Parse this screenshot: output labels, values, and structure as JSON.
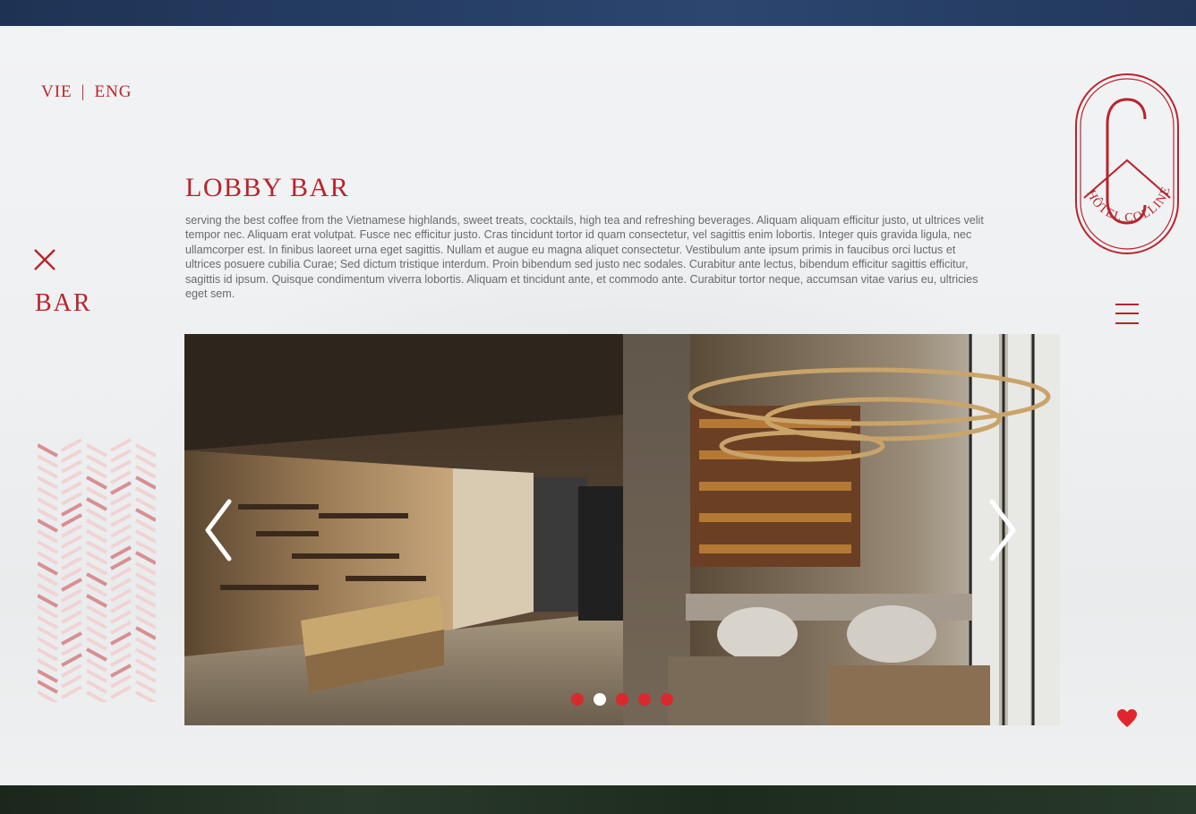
{
  "language_switch": {
    "vie": "VIE",
    "separator": "|",
    "eng": "ENG"
  },
  "section": {
    "label": "BAR"
  },
  "content": {
    "title": "LOBBY BAR",
    "description": "serving the best coffee from the Vietnamese highlands, sweet treats, cocktails, high tea and refreshing beverages. Aliquam aliquam efficitur justo, ut ultrices velit tempor nec. Aliquam erat volutpat. Fusce nec efficitur justo. Cras tincidunt tortor id quam consectetur, vel sagittis enim lobortis. Integer quis gravida ligula, nec ullamcorper est. In finibus laoreet urna eget sagittis. Nullam et augue eu magna aliquet consectetur. Vestibulum ante ipsum primis in faucibus orci luctus et ultrices posuere cubilia Curae; Sed dictum tristique interdum. Proin bibendum sed justo nec sodales. Curabitur ante lectus, bibendum efficitur sagittis efficitur, sagittis id ipsum. Quisque condimentum viverra lobortis. Aliquam et tincidunt ante, et commodo ante. Curabitur tortor neque, accumsan vitae varius eu, ultricies eget sem."
  },
  "logo": {
    "text": "HÔTEL COLLINE"
  },
  "slider": {
    "total_slides": 5,
    "active_index": 1
  },
  "colors": {
    "brand_red": "#b8242c",
    "dot_red": "#d9292e",
    "page_bg": "#f0f1f3"
  },
  "icons": [
    "close-icon",
    "menu-icon",
    "heart-icon",
    "chevron-left-icon",
    "chevron-right-icon"
  ]
}
